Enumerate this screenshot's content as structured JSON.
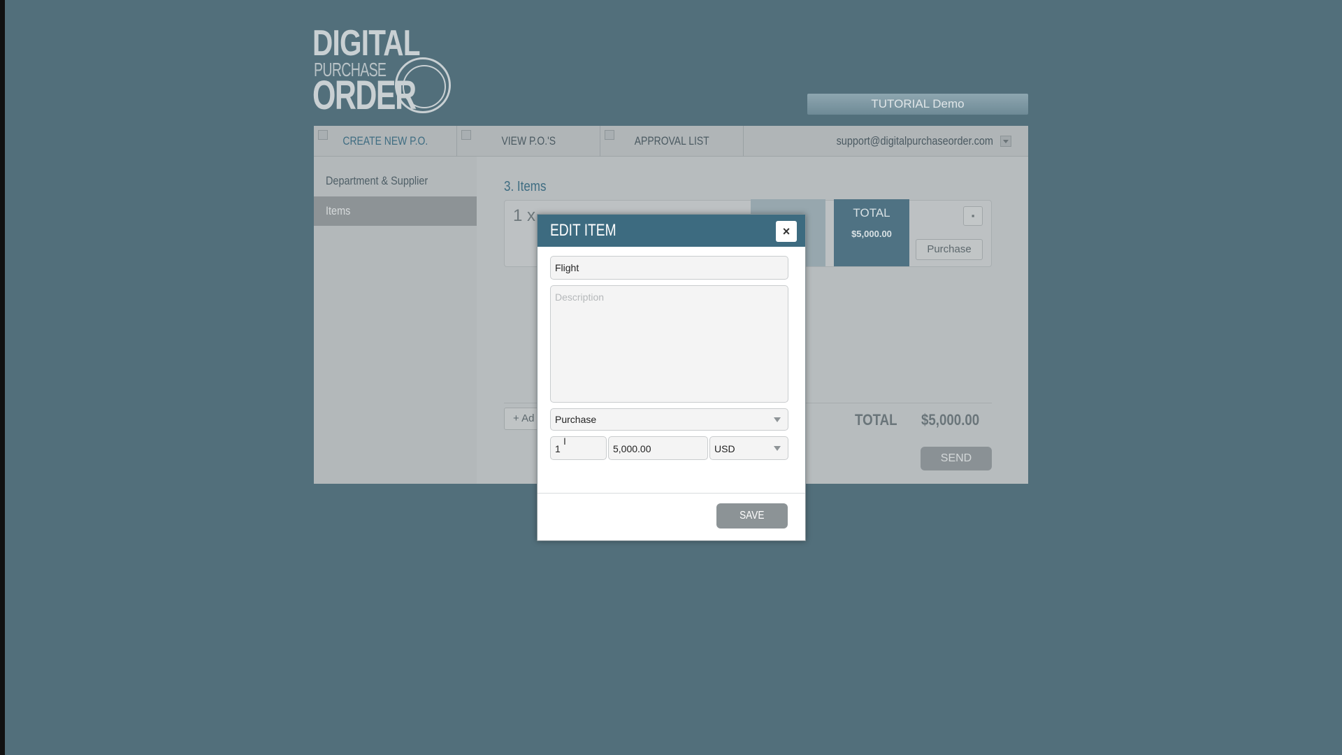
{
  "logo": {
    "line1": "DIGITAL",
    "line2": "PURCHASE",
    "line3": "ORDER"
  },
  "demo_badge": "TUTORIAL Demo",
  "nav": {
    "tabs": [
      {
        "label": "CREATE NEW P.O."
      },
      {
        "label": "VIEW P.O.'S"
      },
      {
        "label": "APPROVAL LIST"
      }
    ],
    "email": "support@digitalpurchaseorder.com"
  },
  "sidebar": {
    "items": [
      {
        "label": "Department & Supplier"
      },
      {
        "label": "Items"
      }
    ]
  },
  "items_section": {
    "title": "3. Items",
    "row": {
      "qty_title": "1 x",
      "total_label": "TOTAL",
      "total_value": "$5,000.00",
      "type_button": "Purchase"
    },
    "add_label": "+ Ad",
    "grand_total_label": "TOTAL",
    "grand_total_value": "$5,000.00",
    "send_label": "SEND"
  },
  "modal": {
    "title": "EDIT ITEM",
    "close_label": "×",
    "name_value": "Flight",
    "description_placeholder": "Description",
    "type_value": "Purchase",
    "qty_value": "1",
    "price_value": "5,000.00",
    "currency_value": "USD",
    "save_label": "SAVE"
  },
  "colors": {
    "background": "#526f7b",
    "accent": "#3d6b80"
  }
}
